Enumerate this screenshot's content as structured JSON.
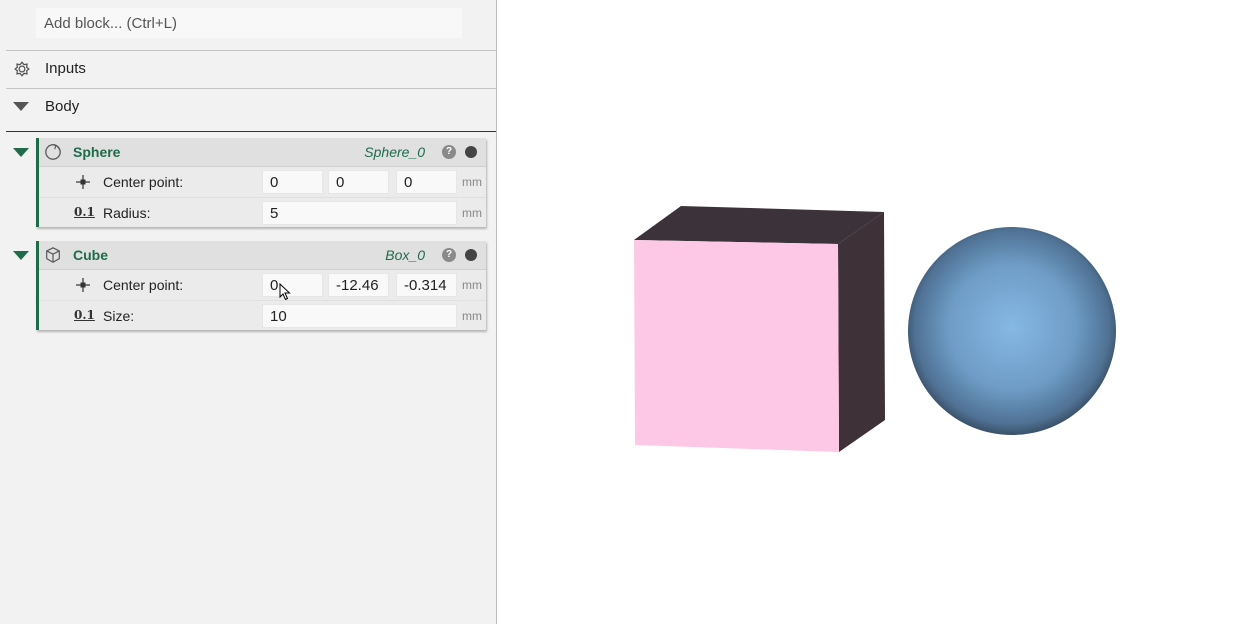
{
  "add_block": {
    "placeholder": "Add block... (Ctrl+L)"
  },
  "sections": {
    "inputs_label": "Inputs",
    "body_label": "Body"
  },
  "nodes": [
    {
      "title": "Sphere",
      "id": "Sphere_0",
      "help": "?",
      "params": [
        {
          "label": "Center point:",
          "values": [
            "0",
            "0",
            "0"
          ],
          "unit": "mm"
        },
        {
          "label": "Radius:",
          "values": [
            "5"
          ],
          "unit": "mm"
        }
      ]
    },
    {
      "title": "Cube",
      "id": "Box_0",
      "help": "?",
      "params": [
        {
          "label": "Center point:",
          "values": [
            "0",
            "-12.46",
            "-0.314"
          ],
          "unit": "mm"
        },
        {
          "label": "Size:",
          "values": [
            "10"
          ],
          "unit": "mm"
        }
      ]
    }
  ],
  "number_icon_text": "0.1",
  "colors": {
    "accent": "#1f6b4a",
    "cube_front": "#fdc8e5",
    "cube_dark": "#3c3239",
    "sphere": "#7aacd8"
  }
}
